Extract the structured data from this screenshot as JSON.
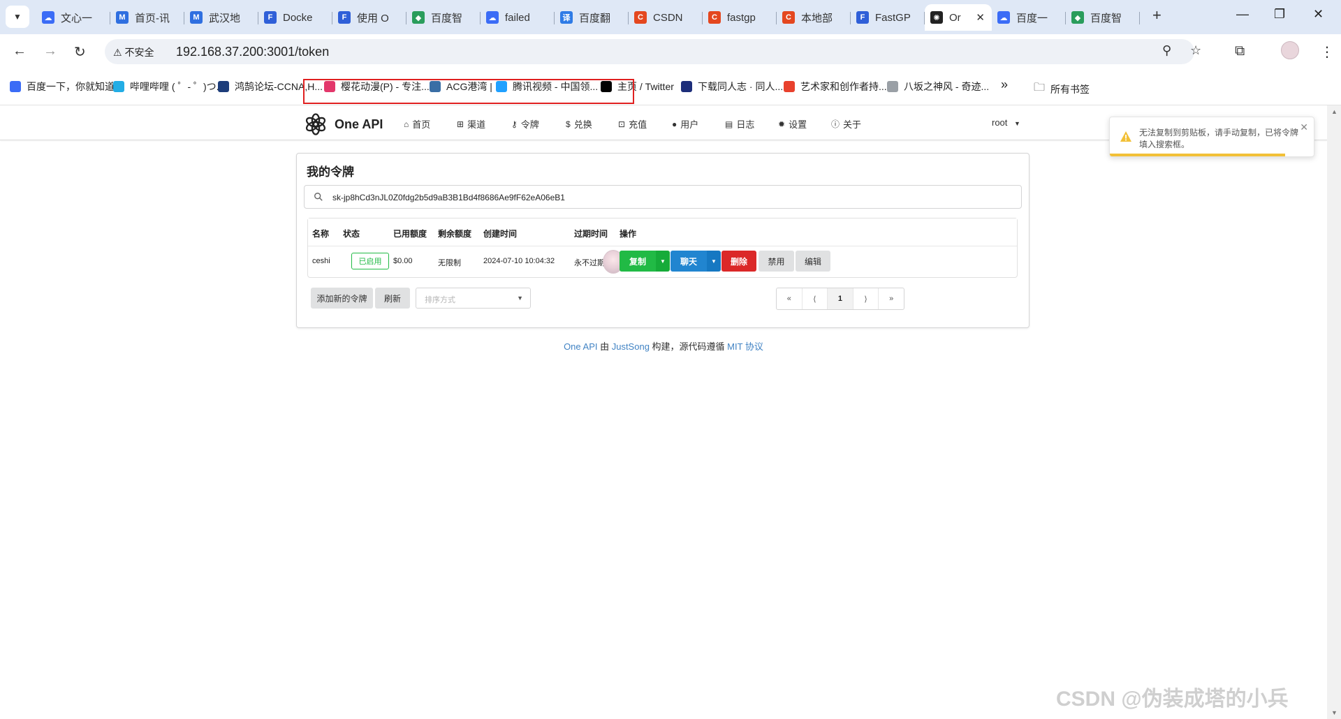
{
  "browser": {
    "tabs": [
      {
        "label": "文心一",
        "icon_color": "#3b6cf6",
        "icon_char": "☁"
      },
      {
        "label": "首页-讯",
        "icon_color": "#2f6fe0",
        "icon_char": "M"
      },
      {
        "label": "武汉地",
        "icon_color": "#2f6fe0",
        "icon_char": "M"
      },
      {
        "label": "Docke",
        "icon_color": "#2f5fd8",
        "icon_char": "F"
      },
      {
        "label": "使用 O",
        "icon_color": "#2f5fd8",
        "icon_char": "F"
      },
      {
        "label": "百度智",
        "icon_color": "#2a9d5c",
        "icon_char": "◆"
      },
      {
        "label": "failed",
        "icon_color": "#3b6cf6",
        "icon_char": "☁"
      },
      {
        "label": "百度翻",
        "icon_color": "#2e7be6",
        "icon_char": "译"
      },
      {
        "label": "CSDN",
        "icon_color": "#e4471f",
        "icon_char": "C"
      },
      {
        "label": "fastgp",
        "icon_color": "#e4471f",
        "icon_char": "C"
      },
      {
        "label": "本地部",
        "icon_color": "#e4471f",
        "icon_char": "C"
      },
      {
        "label": "FastGP",
        "icon_color": "#2f5fd8",
        "icon_char": "F"
      },
      {
        "label": "Or",
        "icon_color": "#222222",
        "icon_char": "✺",
        "active": true
      },
      {
        "label": "百度一",
        "icon_color": "#3b6cf6",
        "icon_char": "☁"
      },
      {
        "label": "百度智",
        "icon_color": "#2a9d5c",
        "icon_char": "◆"
      }
    ],
    "insecure_label": "不安全",
    "url": "192.168.37.200:3001/token",
    "bookmarks": [
      {
        "label": "百度一下，你就知道",
        "icon_color": "#3b6cf6"
      },
      {
        "label": "哔哩哔哩 ( ゜- ゜)つ...",
        "icon_color": "#23ade5"
      },
      {
        "label": "鸿鹄论坛-CCNA,H...",
        "icon_color": "#1d3d7a"
      },
      {
        "label": "樱花动漫(P) - 专注...",
        "icon_color": "#e3376b"
      },
      {
        "label": "ACG港湾 |",
        "icon_color": "#3a6ea5"
      },
      {
        "label": "腾讯视频 - 中国领...",
        "icon_color": "#20a0ff"
      },
      {
        "label": "主页 / Twitter",
        "icon_color": "#000000"
      },
      {
        "label": "下载同人志 · 同人...",
        "icon_color": "#1d2e7a"
      },
      {
        "label": "艺术家和创作者持...",
        "icon_color": "#e8412d"
      },
      {
        "label": "八坂之神风 - 奇迹...",
        "icon_color": "#9aa0a6"
      }
    ],
    "bookmarks_more": "»",
    "all_bookmarks": "所有书签"
  },
  "app": {
    "brand": "One API",
    "nav": [
      {
        "label": "首页",
        "icon": "home-icon",
        "glyph": "⌂"
      },
      {
        "label": "渠道",
        "icon": "sitemap-icon",
        "glyph": "⊞"
      },
      {
        "label": "令牌",
        "icon": "key-icon",
        "glyph": "⚷"
      },
      {
        "label": "兑换",
        "icon": "dollar-icon",
        "glyph": "$"
      },
      {
        "label": "充值",
        "icon": "cart-icon",
        "glyph": "⊡"
      },
      {
        "label": "用户",
        "icon": "user-icon",
        "glyph": "●"
      },
      {
        "label": "日志",
        "icon": "book-icon",
        "glyph": "▤"
      },
      {
        "label": "设置",
        "icon": "gear-icon",
        "glyph": "✹"
      },
      {
        "label": "关于",
        "icon": "info-icon",
        "glyph": "ⓘ"
      }
    ],
    "user": "root"
  },
  "tokens": {
    "title": "我的令牌",
    "search_value": "sk-jp8hCd3nJL0Z0fdg2b5d9aB3B1Bd4f8686Ae9fF62eA06eB1",
    "columns": [
      "名称",
      "状态",
      "已用额度",
      "剩余额度",
      "创建时间",
      "过期时间",
      "操作"
    ],
    "rows": [
      {
        "name": "ceshi",
        "status": "已启用",
        "used": "$0.00",
        "remaining": "无限制",
        "created": "2024-07-10 10:04:32",
        "expires": "永不过期"
      }
    ],
    "row_actions": {
      "copy": "复制",
      "chat": "聊天",
      "delete": "删除",
      "disable": "禁用",
      "edit": "编辑"
    },
    "add_label": "添加新的令牌",
    "refresh_label": "刷新",
    "sort_placeholder": "排序方式",
    "pager": [
      "«",
      "⟨",
      "1",
      "⟩",
      "»"
    ]
  },
  "footer": {
    "brand": "One API",
    "by": " 由 ",
    "author": "JustSong",
    "mid": " 构建，源代码遵循 ",
    "license": "MIT 协议"
  },
  "toast": {
    "message": "无法复制到剪贴板，请手动复制，已将令牌填入搜索框。",
    "remaining_fraction": 0.86
  },
  "watermark": "CSDN @伪装成塔的小兵"
}
